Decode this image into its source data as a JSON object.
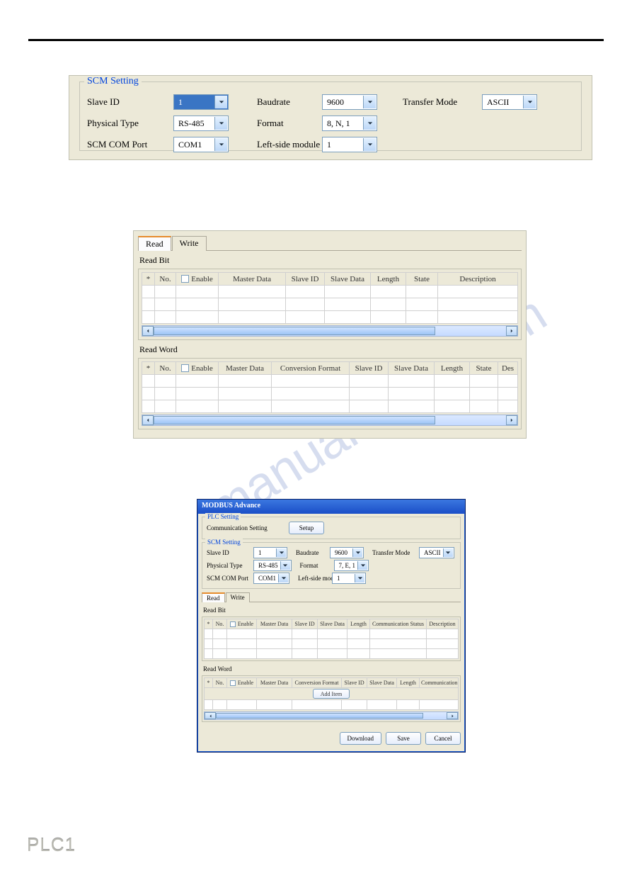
{
  "scm_box": {
    "legend": "SCM Setting",
    "labels": {
      "slave_id": "Slave ID",
      "physical_type": "Physical Type",
      "scm_com_port": "SCM COM Port",
      "baudrate": "Baudrate",
      "format": "Format",
      "left_module": "Left-side module No.",
      "transfer_mode": "Transfer Mode"
    },
    "values": {
      "slave_id": "1",
      "physical_type": "RS-485",
      "scm_com_port": "COM1",
      "baudrate": "9600",
      "format": "8, N, 1",
      "left_module": "1",
      "transfer_mode": "ASCII"
    }
  },
  "rw_panel": {
    "tabs": {
      "read": "Read",
      "write": "Write"
    },
    "read_bit_title": "Read Bit",
    "read_word_title": "Read Word",
    "cols_bit": [
      "*",
      "No.",
      "Enable",
      "Master Data",
      "Slave ID",
      "Slave Data",
      "Length",
      "State",
      "Description"
    ],
    "cols_word": [
      "*",
      "No.",
      "Enable",
      "Master Data",
      "Conversion Format",
      "Slave ID",
      "Slave Data",
      "Length",
      "State",
      "Des"
    ]
  },
  "dlg": {
    "title": "MODBUS Advance",
    "plc_legend": "PLC Setting",
    "comm_setting_label": "Communication Setting",
    "setup_btn": "Setup",
    "scm_legend": "SCM Setting",
    "labels": {
      "slave_id": "Slave ID",
      "physical_type": "Physical Type",
      "scm_com_port": "SCM COM Port",
      "baudrate": "Baudrate",
      "format": "Format",
      "left_module": "Left-side module No.",
      "transfer_mode": "Transfer Mode"
    },
    "values": {
      "slave_id": "1",
      "physical_type": "RS-485",
      "scm_com_port": "COM1",
      "baudrate": "9600",
      "format": "7, E, 1",
      "left_module": "1",
      "transfer_mode": "ASCII"
    },
    "tabs": {
      "read": "Read",
      "write": "Write"
    },
    "read_bit_title": "Read Bit",
    "read_word_title": "Read Word",
    "cols_bit": [
      "*",
      "No.",
      "Enable",
      "Master Data",
      "Slave ID",
      "Slave Data",
      "Length",
      "Communication Status",
      "Description"
    ],
    "cols_word": [
      "*",
      "No.",
      "Enable",
      "Master Data",
      "Conversion Format",
      "Slave ID",
      "Slave Data",
      "Length",
      "Communication"
    ],
    "add_item_btn": "Add Item",
    "buttons": {
      "download": "Download",
      "save": "Save",
      "cancel": "Cancel"
    }
  },
  "watermark": "manualshive.com",
  "plc_badge": "PLC1"
}
